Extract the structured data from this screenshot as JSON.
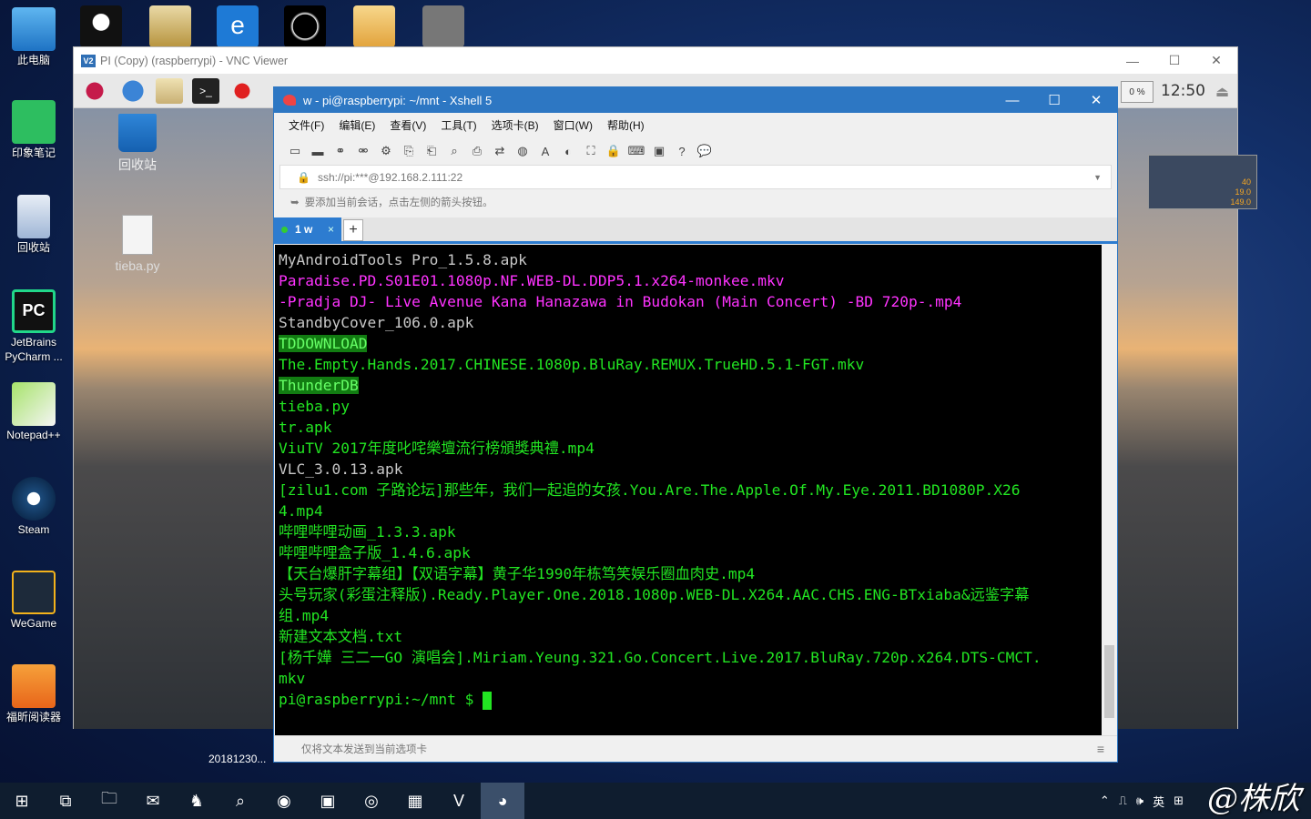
{
  "desktop": {
    "icons": [
      {
        "label": "此电脑",
        "icon": "computer-icon"
      },
      {
        "label": "印象笔记",
        "icon": "evernote-icon"
      },
      {
        "label": "回收站",
        "icon": "recycle-bin-icon"
      },
      {
        "label": "JetBrains PyCharm ...",
        "icon": "pycharm-icon"
      },
      {
        "label": "Notepad++",
        "icon": "notepadpp-icon"
      },
      {
        "label": "Steam",
        "icon": "steam-icon"
      },
      {
        "label": "WeGame",
        "icon": "wegame-icon"
      },
      {
        "label": "福昕阅读器",
        "icon": "foxit-reader-icon"
      }
    ]
  },
  "vnc": {
    "title": "PI (Copy) (raspberrypi) - VNC Viewer",
    "pi_panel": {
      "clock": "12:50",
      "cpu": "0 %",
      "monitor_values": [
        "40",
        "19.0",
        "149.0"
      ]
    },
    "pi_desktop": {
      "trash_label": "回收站",
      "file_label": "tieba.py",
      "date_label": "20181230..."
    }
  },
  "xshell": {
    "title": "w - pi@raspberrypi: ~/mnt - Xshell 5",
    "menu": [
      "文件(F)",
      "编辑(E)",
      "查看(V)",
      "工具(T)",
      "选项卡(B)",
      "窗口(W)",
      "帮助(H)"
    ],
    "address": "ssh://pi:***@192.168.2.111:22",
    "hint": "要添加当前会话，点击左侧的箭头按钮。",
    "tab_label": "1 w",
    "status": "仅将文本发送到当前选项卡",
    "terminal_lines": [
      {
        "text": "MyAndroidTools Pro_1.5.8.apk",
        "style": "white"
      },
      {
        "text": "Paradise.PD.S01E01.1080p.NF.WEB-DL.DDP5.1.x264-monkee.mkv",
        "style": "mag"
      },
      {
        "text": "-Pradja DJ- Live Avenue Kana Hanazawa in Budokan (Main Concert) -BD 720p-.mp4",
        "style": "mag"
      },
      {
        "text": "StandbyCover_106.0.apk",
        "style": "white"
      },
      {
        "text": "TDDOWNLOAD",
        "style": "dir"
      },
      {
        "text": "The.Empty.Hands.2017.CHINESE.1080p.BluRay.REMUX.TrueHD.5.1-FGT.mkv",
        "style": "grn"
      },
      {
        "text": "ThunderDB",
        "style": "dir"
      },
      {
        "text": "tieba.py",
        "style": "grn"
      },
      {
        "text": "tr.apk",
        "style": "grn"
      },
      {
        "text": "ViuTV 2017年度叱咤樂壇流行榜頒獎典禮.mp4",
        "style": "grn"
      },
      {
        "text": "VLC_3.0.13.apk",
        "style": "white"
      },
      {
        "text": "[zilu1.com 子路论坛]那些年，我们一起追的女孩.You.Are.The.Apple.Of.My.Eye.2011.BD1080P.X26",
        "style": "grn"
      },
      {
        "text": "4.mp4",
        "style": "grn"
      },
      {
        "text": "哔哩哔哩动画_1.3.3.apk",
        "style": "grn"
      },
      {
        "text": "哔哩哔哩盒子版_1.4.6.apk",
        "style": "grn"
      },
      {
        "text": "【天台爆肝字幕组】【双语字幕】黄子华1990年栋笃笑娱乐圈血肉史.mp4",
        "style": "grn"
      },
      {
        "text": "头号玩家(彩蛋注释版).Ready.Player.One.2018.1080p.WEB-DL.X264.AAC.CHS.ENG-BTxiaba&远鉴字幕",
        "style": "grn"
      },
      {
        "text": "组.mp4",
        "style": "grn"
      },
      {
        "text": "新建文本文档.txt",
        "style": "grn"
      },
      {
        "text": "[杨千嬅 三二一GO 演唱会].Miriam.Yeung.321.Go.Concert.Live.2017.BluRay.720p.x264.DTS-CMCT.",
        "style": "grn"
      },
      {
        "text": "mkv",
        "style": "grn"
      }
    ],
    "prompt": "pi@raspberrypi:~/mnt $ "
  },
  "taskbar": {
    "tray_ime": "英",
    "tray_volume": "🕪",
    "watermark": "@株欣"
  }
}
